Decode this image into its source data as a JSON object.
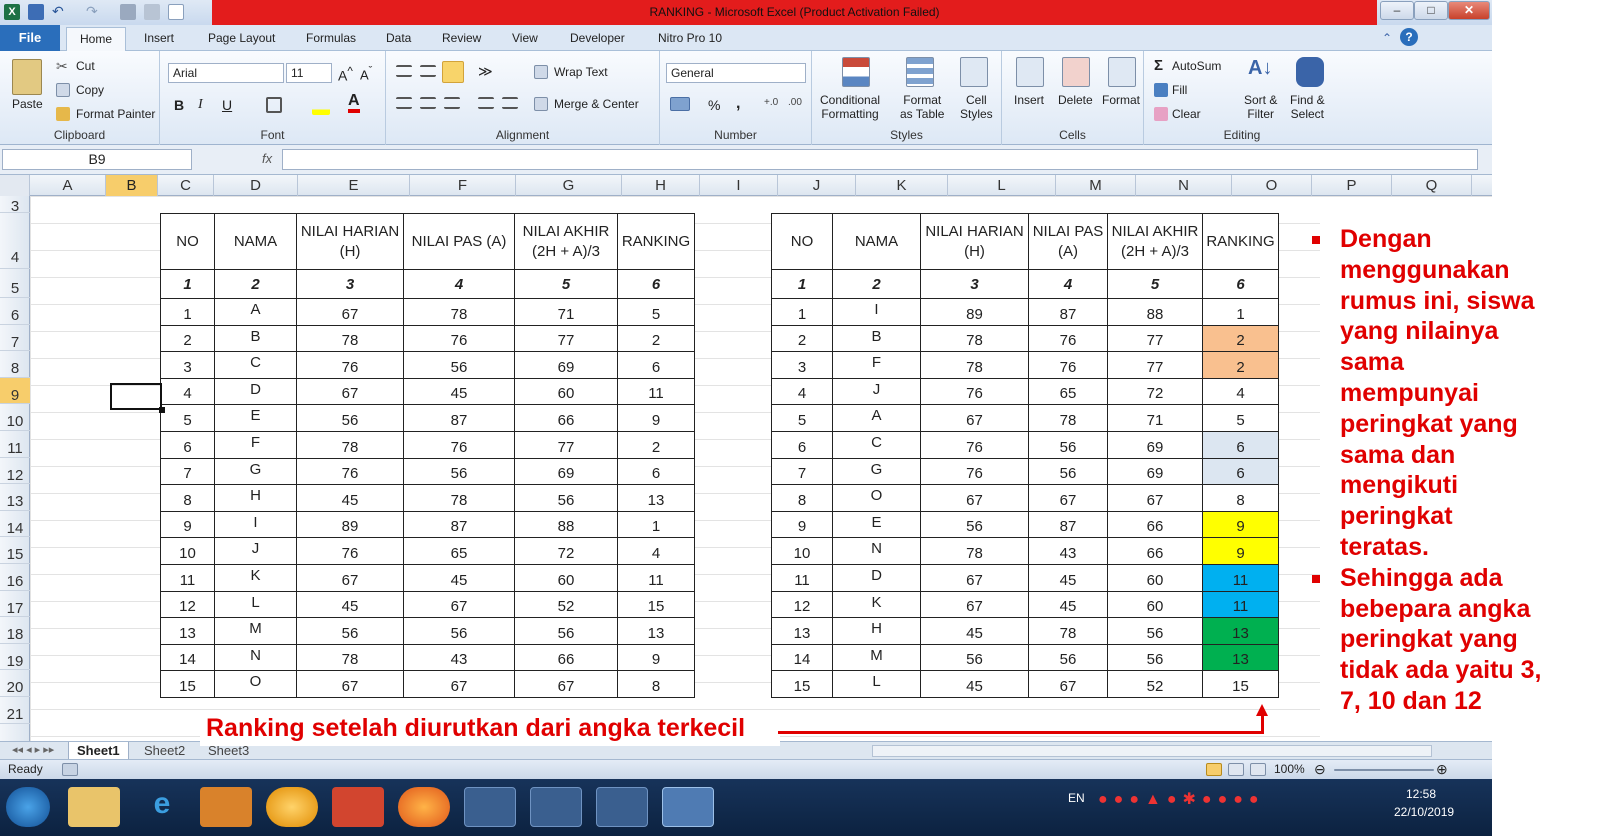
{
  "window": {
    "title": "RANKING  -  Microsoft Excel (Product Activation Failed)"
  },
  "menu": {
    "file": "File",
    "tabs": [
      "Home",
      "Insert",
      "Page Layout",
      "Formulas",
      "Data",
      "Review",
      "View",
      "Developer",
      "Nitro Pro 10"
    ]
  },
  "ribbon": {
    "clipboard": {
      "paste": "Paste",
      "cut": "Cut",
      "copy": "Copy",
      "format_painter": "Format Painter",
      "label": "Clipboard"
    },
    "font": {
      "name": "Arial",
      "size": "11",
      "label": "Font",
      "bold": "B",
      "italic": "I",
      "underline": "U"
    },
    "alignment": {
      "wrap_text": "Wrap Text",
      "merge_center": "Merge & Center",
      "label": "Alignment"
    },
    "number": {
      "format": "General",
      "percent": "%",
      "comma": ",",
      "label": "Number"
    },
    "styles": {
      "conditional": [
        "Conditional",
        "Formatting"
      ],
      "format_table": [
        "Format",
        "as Table"
      ],
      "cell_styles": [
        "Cell",
        "Styles"
      ],
      "label": "Styles"
    },
    "cells": {
      "insert": "Insert",
      "delete": "Delete",
      "format": "Format",
      "label": "Cells"
    },
    "editing": {
      "autosum": "AutoSum",
      "fill": "Fill",
      "clear": "Clear",
      "sort_filter": [
        "Sort &",
        "Filter"
      ],
      "find_select": [
        "Find &",
        "Select"
      ],
      "label": "Editing"
    }
  },
  "formula_bar": {
    "name_box": "B9",
    "fx": "fx",
    "value": ""
  },
  "columns": [
    "A",
    "B",
    "C",
    "D",
    "E",
    "F",
    "G",
    "H",
    "I",
    "J",
    "K",
    "L",
    "M",
    "N",
    "O",
    "P",
    "Q"
  ],
  "selected_column": "B",
  "rows": [
    "3",
    "4",
    "5",
    "6",
    "7",
    "8",
    "9",
    "10",
    "11",
    "12",
    "13",
    "14",
    "15",
    "16",
    "17",
    "18",
    "19",
    "20",
    "21"
  ],
  "selected_row": "9",
  "table_left": {
    "headers": [
      "NO",
      "NAMA",
      "NILAI HARIAN (H)",
      "NILAI PAS (A)",
      "NILAI AKHIR (2H + A)/3",
      "RANKING"
    ],
    "index_row": [
      "1",
      "2",
      "3",
      "4",
      "5",
      "6"
    ],
    "rows": [
      [
        "1",
        "A",
        "67",
        "78",
        "71",
        "5"
      ],
      [
        "2",
        "B",
        "78",
        "76",
        "77",
        "2"
      ],
      [
        "3",
        "C",
        "76",
        "56",
        "69",
        "6"
      ],
      [
        "4",
        "D",
        "67",
        "45",
        "60",
        "11"
      ],
      [
        "5",
        "E",
        "56",
        "87",
        "66",
        "9"
      ],
      [
        "6",
        "F",
        "78",
        "76",
        "77",
        "2"
      ],
      [
        "7",
        "G",
        "76",
        "56",
        "69",
        "6"
      ],
      [
        "8",
        "H",
        "45",
        "78",
        "56",
        "13"
      ],
      [
        "9",
        "I",
        "89",
        "87",
        "88",
        "1"
      ],
      [
        "10",
        "J",
        "76",
        "65",
        "72",
        "4"
      ],
      [
        "11",
        "K",
        "67",
        "45",
        "60",
        "11"
      ],
      [
        "12",
        "L",
        "45",
        "67",
        "52",
        "15"
      ],
      [
        "13",
        "M",
        "56",
        "56",
        "56",
        "13"
      ],
      [
        "14",
        "N",
        "78",
        "43",
        "66",
        "9"
      ],
      [
        "15",
        "O",
        "67",
        "67",
        "67",
        "8"
      ]
    ]
  },
  "table_right": {
    "headers": [
      "NO",
      "NAMA",
      "NILAI HARIAN (H)",
      "NILAI PAS (A)",
      "NILAI AKHIR (2H + A)/3",
      "RANKING"
    ],
    "index_row": [
      "1",
      "2",
      "3",
      "4",
      "5",
      "6"
    ],
    "rows": [
      [
        "1",
        "I",
        "89",
        "87",
        "88",
        "1"
      ],
      [
        "2",
        "B",
        "78",
        "76",
        "77",
        "2"
      ],
      [
        "3",
        "F",
        "78",
        "76",
        "77",
        "2"
      ],
      [
        "4",
        "J",
        "76",
        "65",
        "72",
        "4"
      ],
      [
        "5",
        "A",
        "67",
        "78",
        "71",
        "5"
      ],
      [
        "6",
        "C",
        "76",
        "56",
        "69",
        "6"
      ],
      [
        "7",
        "G",
        "76",
        "56",
        "69",
        "6"
      ],
      [
        "8",
        "O",
        "67",
        "67",
        "67",
        "8"
      ],
      [
        "9",
        "E",
        "56",
        "87",
        "66",
        "9"
      ],
      [
        "10",
        "N",
        "78",
        "43",
        "66",
        "9"
      ],
      [
        "11",
        "D",
        "67",
        "45",
        "60",
        "11"
      ],
      [
        "12",
        "K",
        "67",
        "45",
        "60",
        "11"
      ],
      [
        "13",
        "H",
        "45",
        "78",
        "56",
        "13"
      ],
      [
        "14",
        "M",
        "56",
        "56",
        "56",
        "13"
      ],
      [
        "15",
        "L",
        "45",
        "67",
        "52",
        "15"
      ]
    ],
    "rank_fill": [
      "",
      "#f9c08f",
      "#f9c08f",
      "",
      "",
      "#dce6f1",
      "#dce6f1",
      "",
      "#ffff00",
      "#ffff00",
      "#00b0f0",
      "#00b0f0",
      "#00b050",
      "#00b050",
      ""
    ]
  },
  "annotation_bottom": "Ranking setelah diurutkan dari angka terkecil",
  "annotation_side": [
    [
      "Dengan",
      "menggunakan",
      "rumus ini, siswa",
      "yang nilainya",
      "sama",
      "mempunyai",
      "peringkat yang",
      "sama dan",
      "mengikuti",
      "peringkat",
      "teratas."
    ],
    [
      "Sehingga ada",
      "bebepara  angka",
      "peringkat yang",
      "tidak ada yaitu 3,",
      "7, 10 dan 12"
    ]
  ],
  "sheet_tabs": [
    "Sheet1",
    "Sheet2",
    "Sheet3"
  ],
  "status": {
    "ready": "Ready",
    "zoom": "100%"
  },
  "taskbar": {
    "lang": "EN",
    "time": "12:58",
    "date": "22/10/2019"
  },
  "colors": {
    "annotation": "#e00000",
    "title_bar": "#e31c1c",
    "file_tab": "#2a6ebb"
  }
}
